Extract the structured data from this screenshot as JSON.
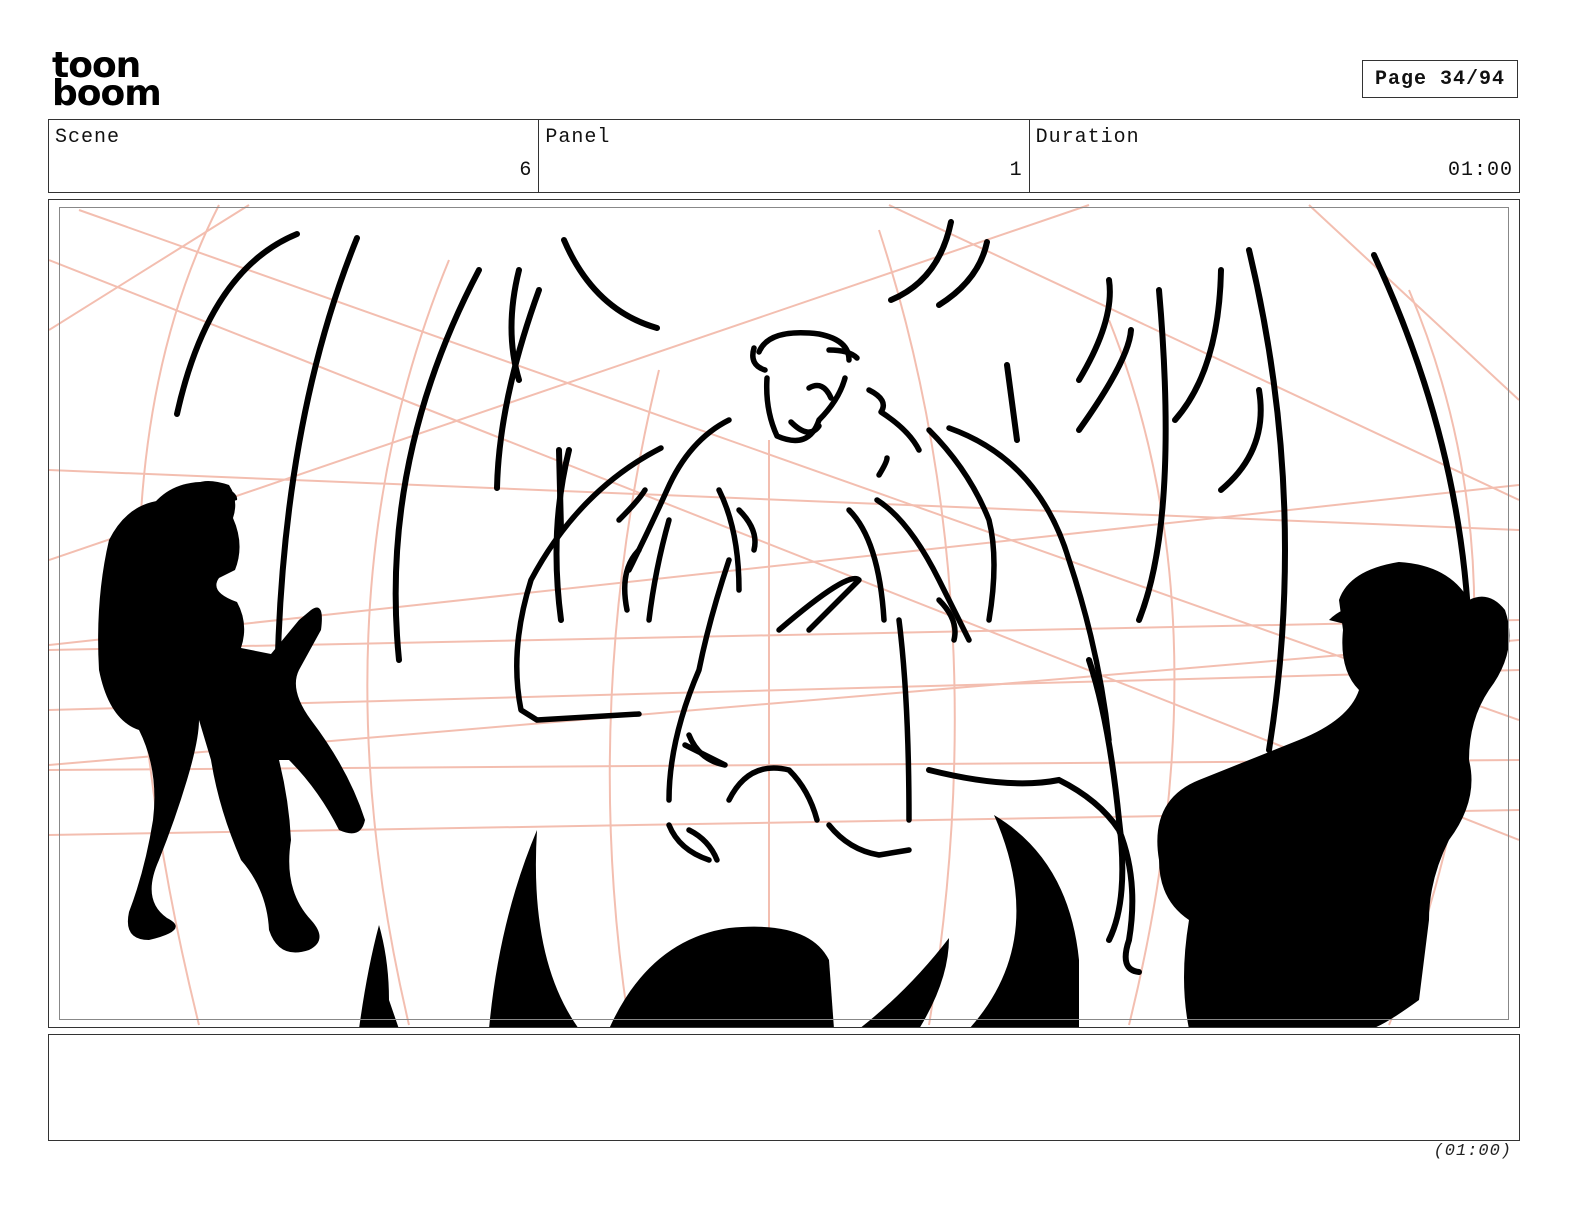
{
  "brand": {
    "logo_line1": "toon",
    "logo_line2": "boom",
    "logo_icon": "toon-boom-logo"
  },
  "page": {
    "label": "Page 34/94"
  },
  "info": {
    "scene_label": "Scene",
    "scene_value": "6",
    "panel_label": "Panel",
    "panel_value": "1",
    "duration_label": "Duration",
    "duration_value": "01:00"
  },
  "notes": {
    "text": ""
  },
  "footer": {
    "duration": "(01:00)"
  },
  "colors": {
    "guide_lines": "#f2b8a8",
    "ink": "#000000",
    "border": "#333333"
  }
}
